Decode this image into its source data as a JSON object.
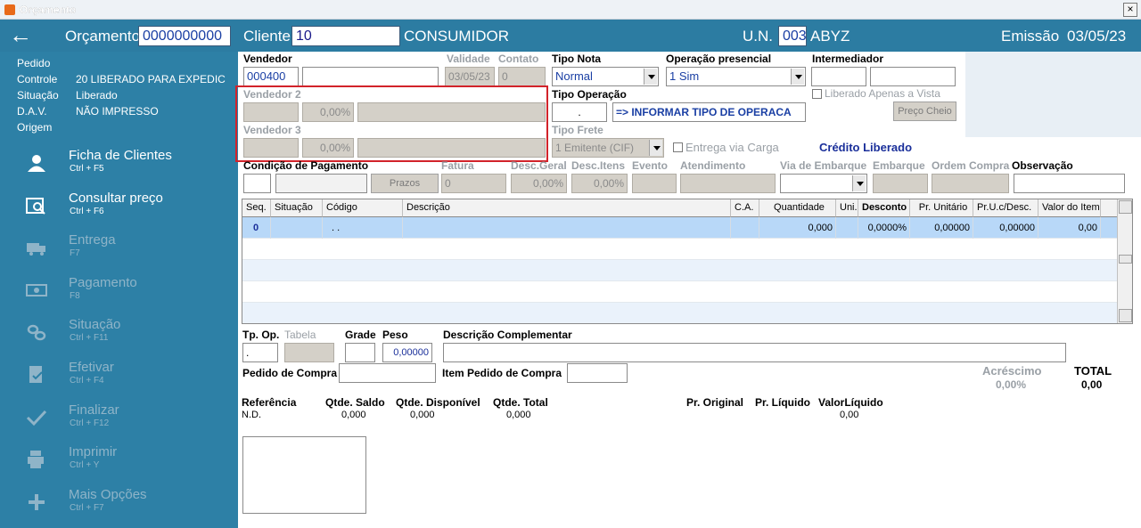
{
  "window": {
    "title": "Orçamento",
    "close": "×"
  },
  "header": {
    "back": "←",
    "orcamento_label": "Orçamento",
    "orcamento_value": "0000000000",
    "cliente_label": "Cliente",
    "cliente_code": "10",
    "cliente_name": "CONSUMIDOR",
    "un_label": "U.N.",
    "un_code": "003",
    "un_name": "ABYZ",
    "emissao_label": "Emissão",
    "emissao_value": "03/05/23"
  },
  "sidebar": {
    "info": [
      {
        "label": "Pedido",
        "value": ""
      },
      {
        "label": "Controle",
        "value": "20   LIBERADO PARA EXPEDIC"
      },
      {
        "label": "Situação",
        "value": "Liberado"
      },
      {
        "label": "D.A.V.",
        "value": "NÃO IMPRESSO"
      },
      {
        "label": "Origem",
        "value": ""
      }
    ],
    "menu": [
      {
        "label": "Ficha de Clientes",
        "shortcut": "Ctrl + F5",
        "icon": "users-icon"
      },
      {
        "label": "Consultar preço",
        "shortcut": "Ctrl + F6",
        "icon": "search-price-icon"
      },
      {
        "label": "Entrega",
        "shortcut": "F7",
        "icon": "truck-icon"
      },
      {
        "label": "Pagamento",
        "shortcut": "F8",
        "icon": "money-icon"
      },
      {
        "label": "Situação",
        "shortcut": "Ctrl + F11",
        "icon": "link-icon"
      },
      {
        "label": "Efetivar",
        "shortcut": "Ctrl + F4",
        "icon": "document-check-icon"
      },
      {
        "label": "Finalizar",
        "shortcut": "Ctrl + F12",
        "icon": "checkmark-icon"
      },
      {
        "label": "Imprimir",
        "shortcut": "Ctrl + Y",
        "icon": "printer-icon"
      },
      {
        "label": "Mais Opções",
        "shortcut": "Ctrl + F7",
        "icon": "plus-icon"
      }
    ]
  },
  "form": {
    "vendedor_label": "Vendedor",
    "vendedor_code": "000400",
    "validade_label": "Validade",
    "validade_value": "03/05/23",
    "contato_label": "Contato",
    "contato_value": "0",
    "tipo_nota_label": "Tipo Nota",
    "tipo_nota_value": "Normal",
    "operacao_presencial_label": "Operação presencial",
    "operacao_presencial_value": "1 Sim",
    "intermediador_label": "Intermediador",
    "vendedor2_label": "Vendedor 2",
    "vendedor2_pct": "0,00%",
    "vendedor3_label": "Vendedor 3",
    "vendedor3_pct": "0,00%",
    "tipo_operacao_label": "Tipo Operação",
    "tipo_operacao_code": ".",
    "tipo_operacao_value": "=> INFORMAR TIPO DE OPERACA",
    "liberado_vista_label": "Liberado Apenas a Vista",
    "preco_cheio_label": "Preço Cheio",
    "tipo_frete_label": "Tipo Frete",
    "tipo_frete_value": "1 Emitente (CIF)",
    "entrega_carga_label": "Entrega via Carga",
    "credito_label": "Crédito Liberado",
    "condicao_label": "Condição de Pagamento",
    "prazos_label": "Prazos",
    "fatura_label": "Fatura",
    "fatura_value": "0",
    "desc_geral_label": "Desc.Geral",
    "desc_geral_value": "0,00%",
    "desc_itens_label": "Desc.Itens",
    "desc_itens_value": "0,00%",
    "evento_label": "Evento",
    "atendimento_label": "Atendimento",
    "via_embarque_label": "Via de Embarque",
    "embarque_label": "Embarque",
    "ordem_compra_label": "Ordem Compra",
    "observacao_label": "Observação"
  },
  "grid": {
    "columns": [
      "Seq.",
      "Situação",
      "Código",
      "Descrição",
      "C.A.",
      "Quantidade",
      "Uni.",
      "Desconto",
      "Pr. Unitário",
      "Pr.U.c/Desc.",
      "Valor do Item"
    ],
    "rows": [
      [
        "0",
        "",
        ". .",
        "",
        "",
        "0,000",
        "",
        "0,0000%",
        "0,00000",
        "0,00000",
        "0,00"
      ]
    ]
  },
  "bottom": {
    "tp_op_label": "Tp. Op.",
    "tp_op_value": ".",
    "tabela_label": "Tabela",
    "grade_label": "Grade",
    "peso_label": "Peso",
    "peso_value": "0,00000",
    "desc_complementar_label": "Descrição Complementar",
    "pedido_compra_label": "Pedido de Compra",
    "item_pedido_compra_label": "Item Pedido de Compra",
    "acrescimo_label": "Acréscimo",
    "acrescimo_value": "0,00%",
    "total_label": "TOTAL",
    "total_value": "0,00",
    "referencia_label": "Referência",
    "referencia_value": "N.D.",
    "qtde_saldo_label": "Qtde. Saldo",
    "qtde_saldo_value": "0,000",
    "qtde_disponivel_label": "Qtde. Disponível",
    "qtde_disponivel_value": "0,000",
    "qtde_total_label": "Qtde. Total",
    "qtde_total_value": "0,000",
    "pr_original_label": "Pr. Original",
    "pr_liquido_label": "Pr. Líquido",
    "valor_liquido_label": "ValorLíquido",
    "valor_liquido_value": "0,00"
  }
}
